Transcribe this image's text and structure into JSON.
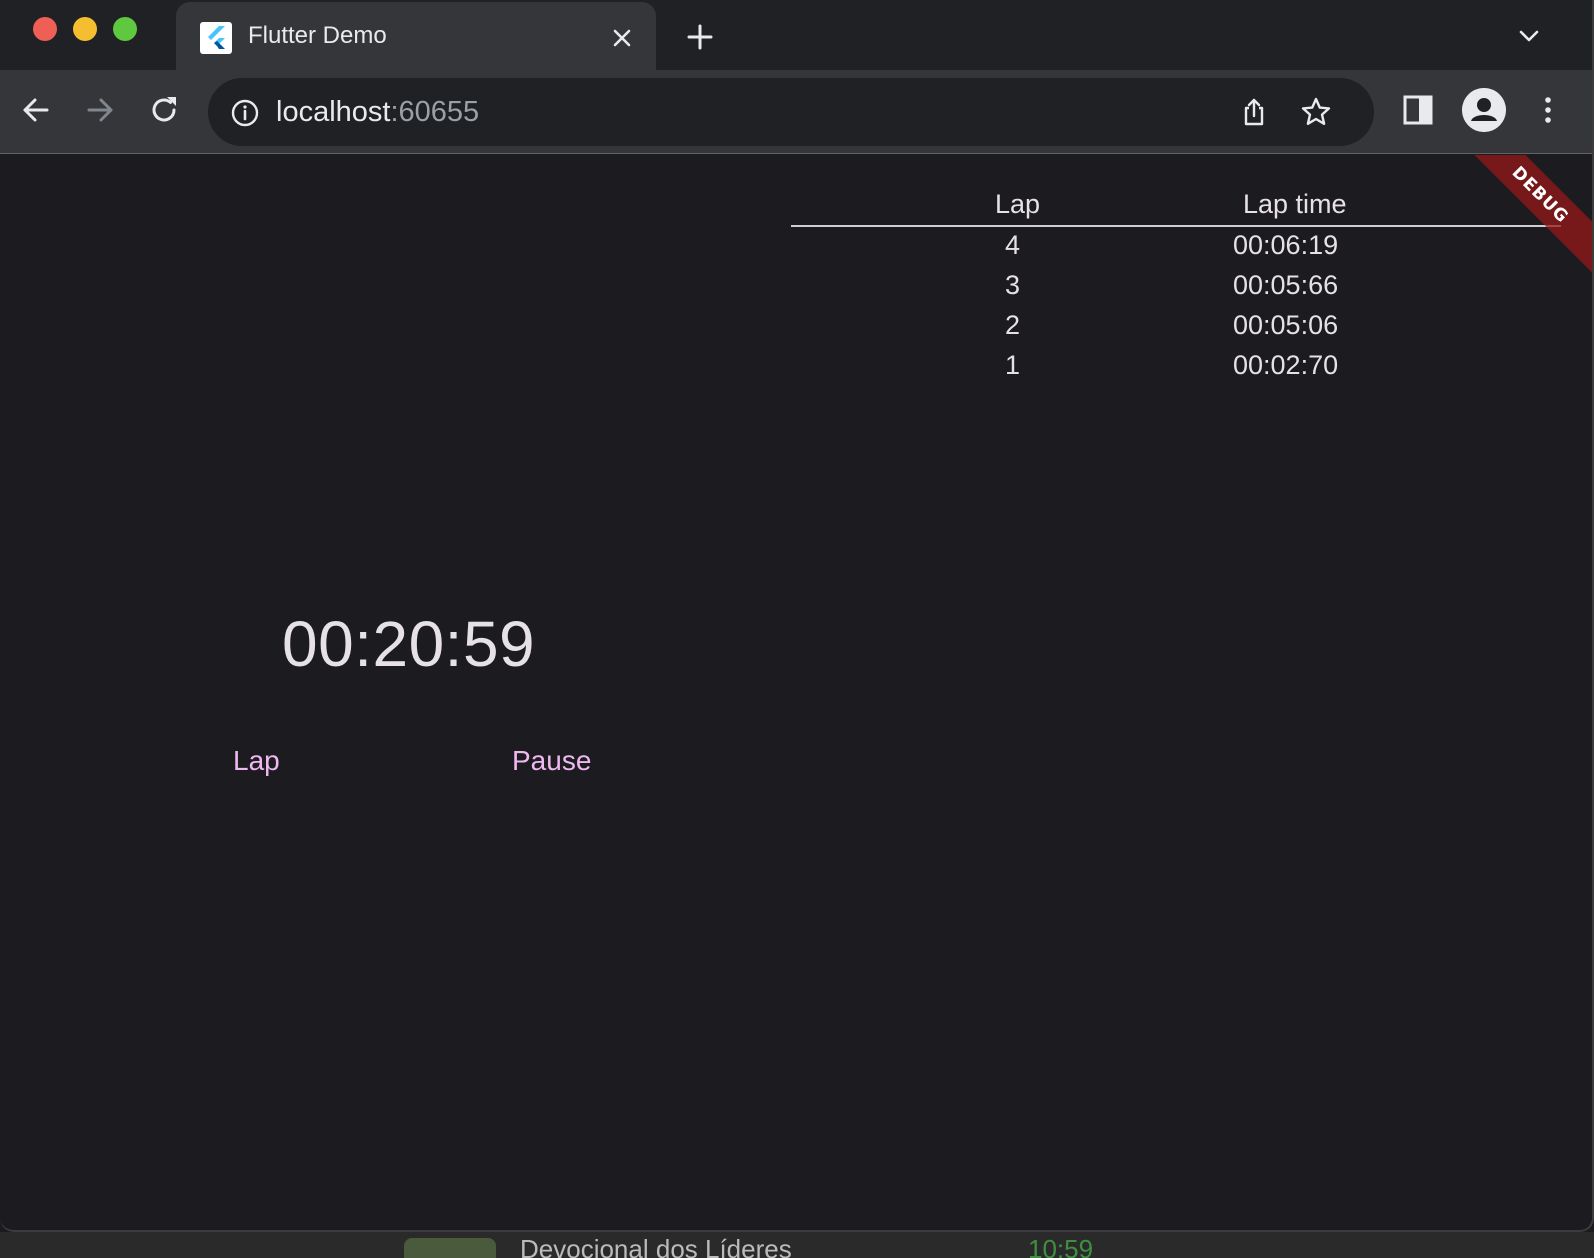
{
  "browser": {
    "tab_title": "Flutter Demo",
    "url_host": "localhost",
    "url_port": ":60655",
    "icons": {
      "favicon": "flutter-logo-icon",
      "close_tab": "close-icon",
      "new_tab": "plus-icon",
      "tab_search": "chevron-down-icon",
      "back": "arrow-left-icon",
      "forward": "arrow-right-icon",
      "reload": "reload-icon",
      "site_info": "info-icon",
      "share": "share-icon",
      "bookmark": "star-icon",
      "side_panel": "side-panel-icon",
      "profile": "profile-icon",
      "menu": "kebab-menu-icon"
    },
    "colors": {
      "close": "#ee5f57",
      "minimize": "#f5bd30",
      "maximize": "#5fc83f"
    }
  },
  "app": {
    "lap_table": {
      "headers": [
        "Lap",
        "Lap time"
      ],
      "rows": [
        {
          "lap": "4",
          "time": "00:06:19"
        },
        {
          "lap": "3",
          "time": "00:05:66"
        },
        {
          "lap": "2",
          "time": "00:05:06"
        },
        {
          "lap": "1",
          "time": "00:02:70"
        }
      ]
    },
    "elapsed_time": "00:20:59",
    "buttons": {
      "lap": "Lap",
      "pause": "Pause"
    },
    "debug_banner": "DEBUG",
    "colors": {
      "background": "#1c1b1f",
      "text": "#e6e1e5",
      "button_text": "#efb8f0",
      "debug_banner": "#961919"
    }
  },
  "background_window": {
    "partial_text": "Devocional dos Líderes",
    "partial_time": "10:59"
  }
}
